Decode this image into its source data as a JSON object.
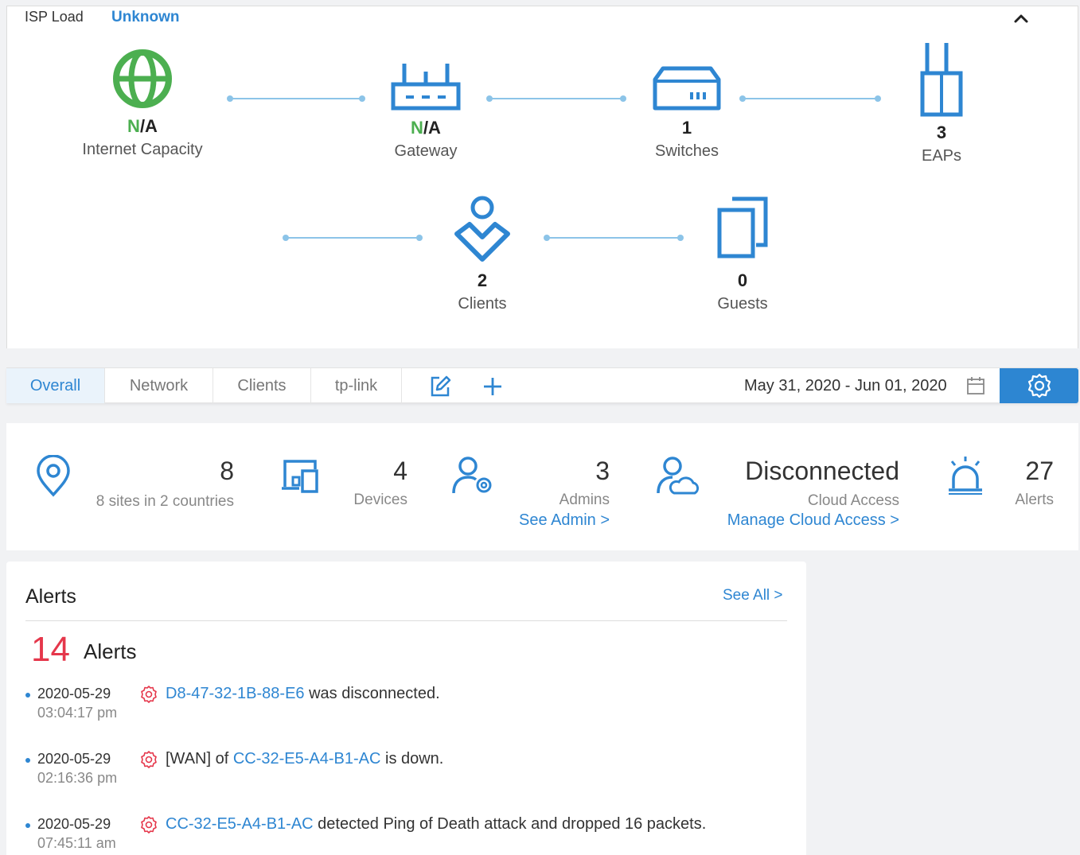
{
  "topology": {
    "isp_label": "ISP Load",
    "isp_value": "Unknown",
    "nodes": {
      "internet": {
        "value_prefix": "N",
        "value_suffix": "/A",
        "label": "Internet Capacity"
      },
      "gateway": {
        "value_prefix": "N",
        "value_suffix": "/A",
        "label": "Gateway"
      },
      "switches": {
        "value": "1",
        "label": "Switches"
      },
      "eaps": {
        "value": "3",
        "label": "EAPs"
      },
      "clients": {
        "value": "2",
        "label": "Clients"
      },
      "guests": {
        "value": "0",
        "label": "Guests"
      }
    },
    "colors": {
      "icon": "#2e86d2",
      "internet_icon": "#4caf50",
      "link": "#8cc4e8"
    }
  },
  "tabs": {
    "items": [
      {
        "label": "Overall",
        "active": true
      },
      {
        "label": "Network"
      },
      {
        "label": "Clients"
      },
      {
        "label": "tp-link"
      }
    ],
    "date_range": "May 31, 2020 - Jun 01, 2020"
  },
  "stats": {
    "sites": {
      "value": "8",
      "sub": "8 sites in 2 countries"
    },
    "devices": {
      "value": "4",
      "sub": "Devices"
    },
    "admins": {
      "value": "3",
      "sub": "Admins",
      "link": "See Admin >"
    },
    "cloud": {
      "value": "Disconnected",
      "sub": "Cloud Access",
      "link": "Manage Cloud Access >"
    },
    "alerts": {
      "value": "27",
      "sub": "Alerts"
    }
  },
  "alerts_card": {
    "title": "Alerts",
    "see_all": "See All >",
    "count": "14",
    "count_label": "Alerts",
    "items": [
      {
        "date": "2020-05-29",
        "time": "03:04:17 pm",
        "pre": "",
        "link": "D8-47-32-1B-88-E6",
        "post": " was disconnected."
      },
      {
        "date": "2020-05-29",
        "time": "02:16:36 pm",
        "pre": "[WAN] of ",
        "link": "CC-32-E5-A4-B1-AC",
        "post": " is down."
      },
      {
        "date": "2020-05-29",
        "time": "07:45:11 am",
        "pre": "",
        "link": "CC-32-E5-A4-B1-AC",
        "post": " detected Ping of Death attack and dropped 16 packets."
      }
    ],
    "colors": {
      "count": "#e5374b",
      "link": "#2e86d2"
    }
  }
}
